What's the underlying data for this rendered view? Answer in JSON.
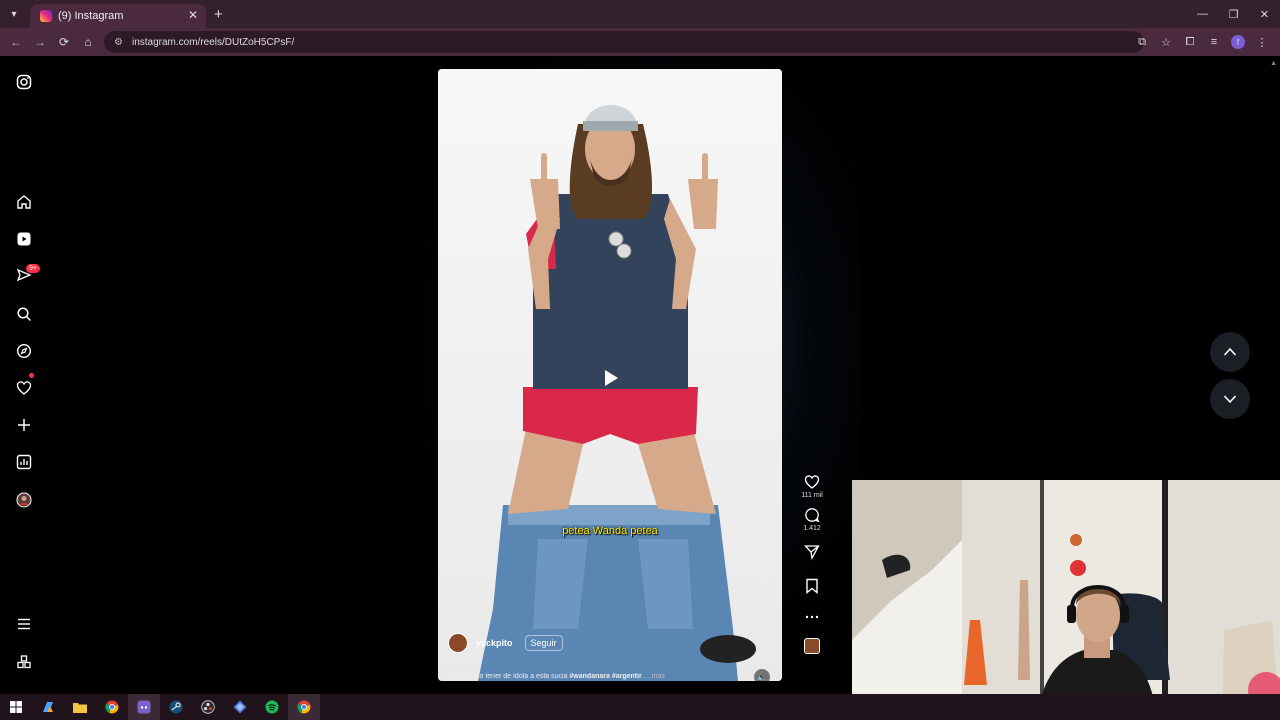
{
  "browser": {
    "tab_title": "(9) Instagram",
    "url": "instagram.com/reels/DUtZoH5CPsF/",
    "colors": {
      "frame": "#35202e",
      "toolbar": "#4b2a40"
    },
    "profile_initial": "f"
  },
  "sidebar": {
    "items": [
      {
        "name": "instagram-logo-icon"
      },
      {
        "name": "home-icon"
      },
      {
        "name": "reels-icon"
      },
      {
        "name": "messages-icon",
        "badge": "9+"
      },
      {
        "name": "search-icon"
      },
      {
        "name": "explore-icon"
      },
      {
        "name": "notifications-icon"
      },
      {
        "name": "create-icon"
      },
      {
        "name": "dashboard-icon"
      },
      {
        "name": "profile-avatar"
      },
      {
        "name": "menu-icon"
      },
      {
        "name": "also-from-meta-icon"
      }
    ]
  },
  "reel": {
    "subtitle": "petea Wanda petea",
    "author": "yackpito",
    "follow_label": "Seguir",
    "caption_text": "No es serio tener de ídola a esta sucia ",
    "caption_tags": "#wandanara #argentir",
    "caption_more": "... más",
    "likes": "111 mil",
    "comments": "1.412"
  },
  "colors": {
    "page_bg": "#000000",
    "accent_red": "#ff3040"
  }
}
